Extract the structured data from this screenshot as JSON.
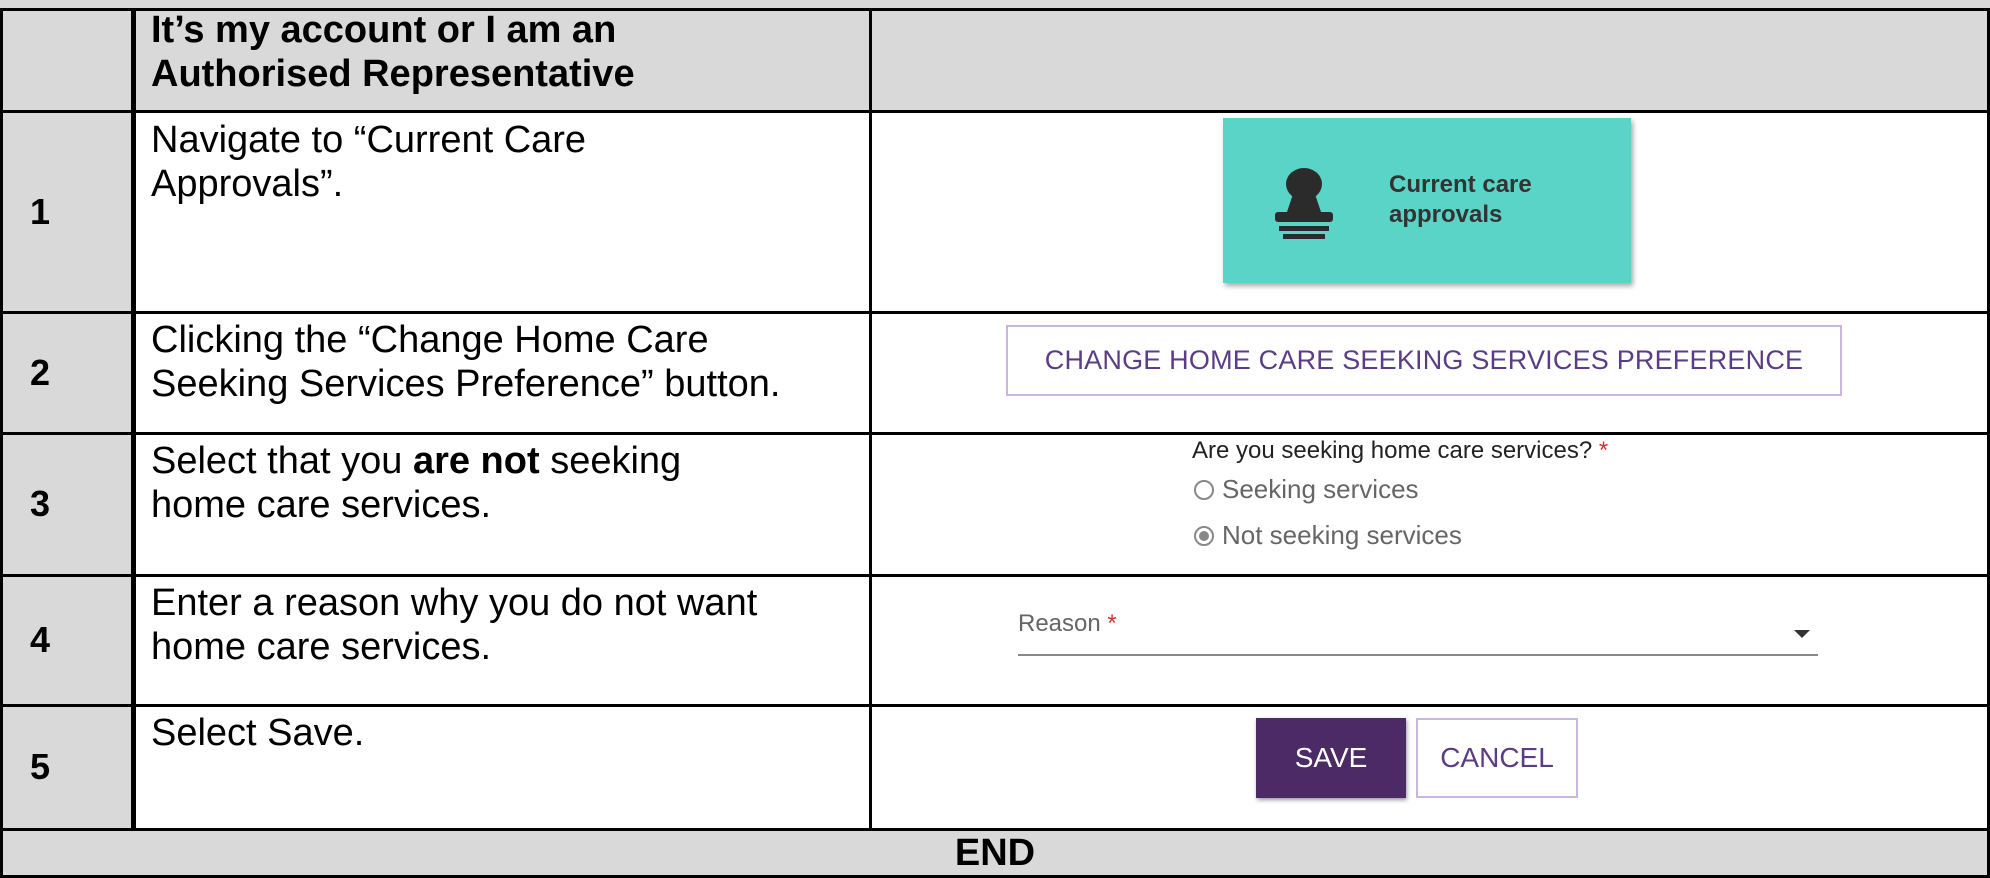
{
  "header": {
    "title_line1": "It’s my account or I am an",
    "title_line2": "Authorised Representative"
  },
  "steps": [
    {
      "number": "1",
      "text_line1": "Navigate to “Current Care",
      "text_line2": "Approvals”."
    },
    {
      "number": "2",
      "text_line1": "Clicking the “Change Home Care",
      "text_line2": "Seeking Services Preference” button."
    },
    {
      "number": "3",
      "text_pre": "Select that you ",
      "text_bold": "are not",
      "text_post": " seeking",
      "text_line2": "home care services."
    },
    {
      "number": "4",
      "text_line1": "Enter a reason why you do not want",
      "text_line2": "home care services."
    },
    {
      "number": "5",
      "text_line1": "Select Save."
    }
  ],
  "tile": {
    "label_line1": "Current care",
    "label_line2": "approvals",
    "icon": "stamp-icon",
    "color": "#5ad4c6"
  },
  "change_button": {
    "label": "CHANGE HOME CARE SEEKING SERVICES PREFERENCE"
  },
  "question": {
    "label": "Are you seeking home care services?",
    "required_mark": "*",
    "options": [
      {
        "label": "Seeking services",
        "selected": false
      },
      {
        "label": "Not seeking services",
        "selected": true
      }
    ]
  },
  "reason": {
    "label": "Reason",
    "required_mark": "*"
  },
  "actions": {
    "save_label": "SAVE",
    "cancel_label": "CANCEL",
    "save_color": "#4b2a66"
  },
  "footer": {
    "end_label": "END"
  }
}
